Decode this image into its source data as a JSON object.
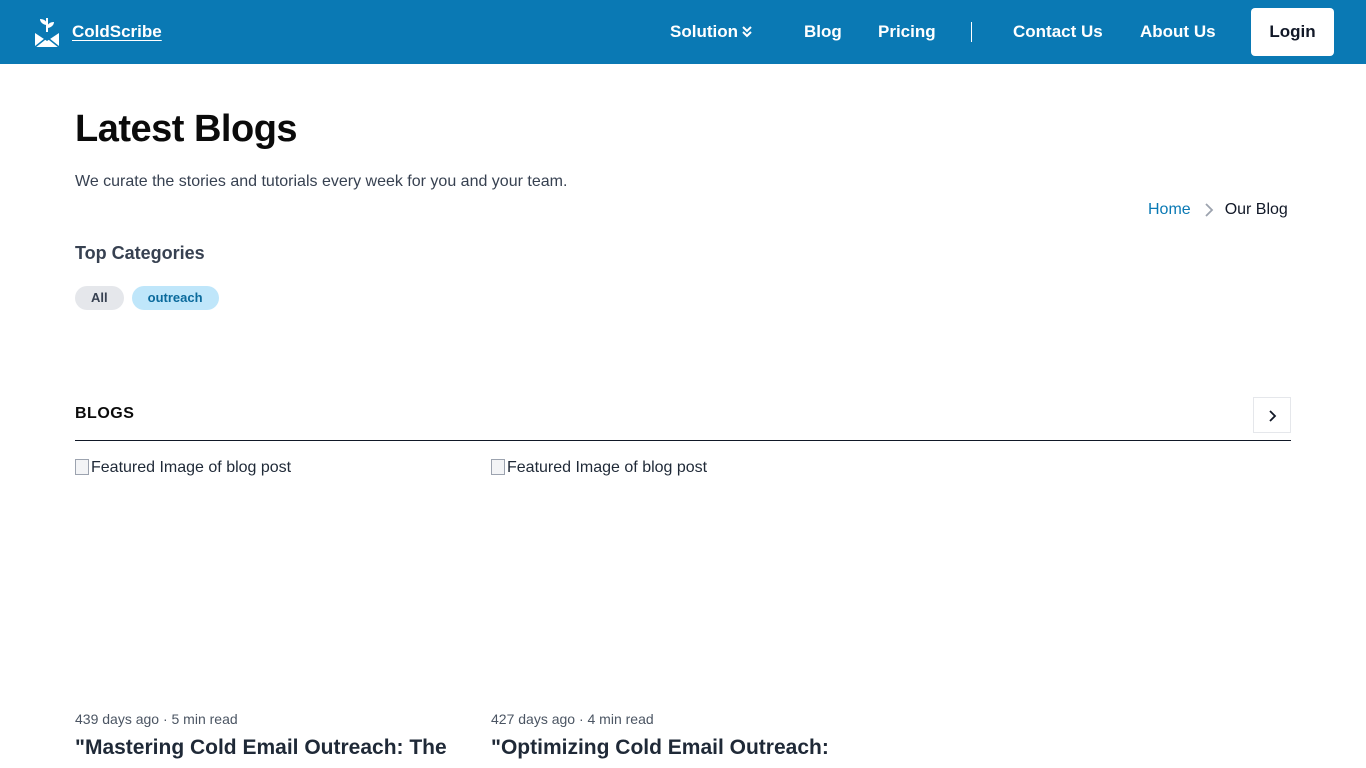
{
  "navbar": {
    "brand_name": "ColdScribe",
    "brand_icon": "envelope-leaf-icon",
    "links": {
      "solution": "Solution",
      "blog": "Blog",
      "pricing": "Pricing",
      "contact": "Contact Us",
      "about": "About Us"
    },
    "solution_icon": "double-chevron-down-icon",
    "login_label": "Login",
    "bg_color": "#0a79b4"
  },
  "hero": {
    "title": "Latest Blogs",
    "subtitle": "We curate the stories and tutorials every week for you and your team."
  },
  "breadcrumb": {
    "home": "Home",
    "current": "Our Blog"
  },
  "categories": {
    "heading": "Top Categories",
    "chips": [
      "All",
      "outreach"
    ]
  },
  "blogs_section": {
    "title": "BLOGS",
    "next_icon": "chevron-right-icon"
  },
  "posts": [
    {
      "image_alt": "Featured Image of blog post",
      "meta": "439 days ago · 5 min read",
      "title": "\"Mastering Cold Email Outreach: The"
    },
    {
      "image_alt": "Featured Image of blog post",
      "meta": "427 days ago · 4 min read",
      "title": "\"Optimizing Cold Email Outreach:"
    }
  ]
}
